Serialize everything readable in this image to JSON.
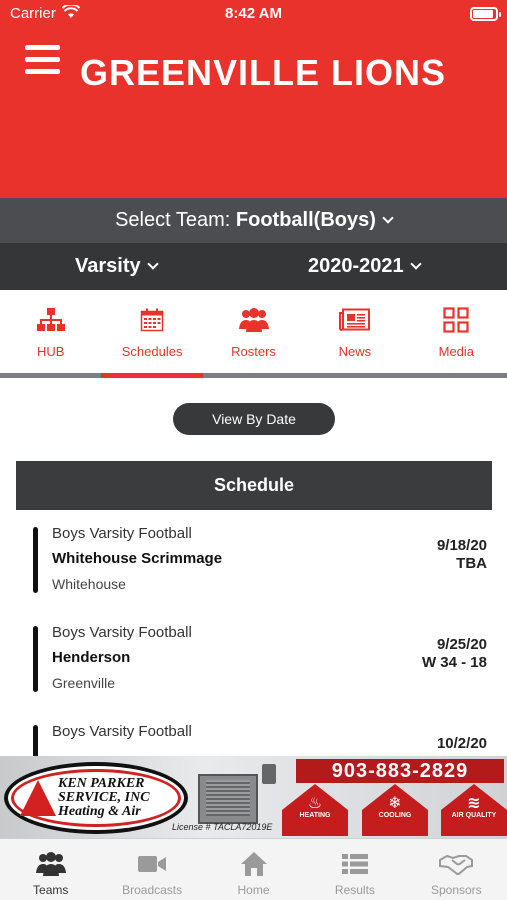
{
  "status_bar": {
    "carrier": "Carrier",
    "time": "8:42 AM"
  },
  "header": {
    "title": "GREENVILLE LIONS"
  },
  "team_select": {
    "prefix": "Select Team:",
    "value": "Football(Boys)"
  },
  "level": {
    "value": "Varsity",
    "season": "2020-2021"
  },
  "tabs": [
    {
      "label": "HUB",
      "icon": "org-chart-icon"
    },
    {
      "label": "Schedules",
      "icon": "calendar-icon"
    },
    {
      "label": "Rosters",
      "icon": "people-icon"
    },
    {
      "label": "News",
      "icon": "newspaper-icon"
    },
    {
      "label": "Media",
      "icon": "grid-icon"
    }
  ],
  "view_button": "View By Date",
  "schedule": {
    "title": "Schedule",
    "games": [
      {
        "sport": "Boys Varsity Football",
        "opponent": "Whitehouse Scrimmage",
        "location": "Whitehouse",
        "date": "9/18/20",
        "result": "TBA"
      },
      {
        "sport": "Boys Varsity Football",
        "opponent": "Henderson",
        "location": "Greenville",
        "date": "9/25/20",
        "result": "W 34 - 18"
      },
      {
        "sport": "Boys Varsity Football",
        "opponent": "",
        "location": "",
        "date": "10/2/20",
        "result": ""
      }
    ]
  },
  "ad": {
    "company_line1": "KEN PARKER",
    "company_line2": "SERVICE, INC",
    "company_line3": "Heating & Air",
    "phone": "903-883-2829",
    "license": "License # TACLA72019E",
    "badges": [
      "HEATING",
      "COOLING",
      "AIR QUALITY"
    ]
  },
  "bottom_nav": [
    {
      "label": "Teams",
      "icon": "people-icon"
    },
    {
      "label": "Broadcasts",
      "icon": "video-camera-icon"
    },
    {
      "label": "Home",
      "icon": "home-icon"
    },
    {
      "label": "Results",
      "icon": "list-icon"
    },
    {
      "label": "Sponsors",
      "icon": "handshake-icon"
    }
  ],
  "colors": {
    "brand_red": "#e8322b",
    "dark_bar": "#353638",
    "mid_bar": "#4b4d50"
  }
}
